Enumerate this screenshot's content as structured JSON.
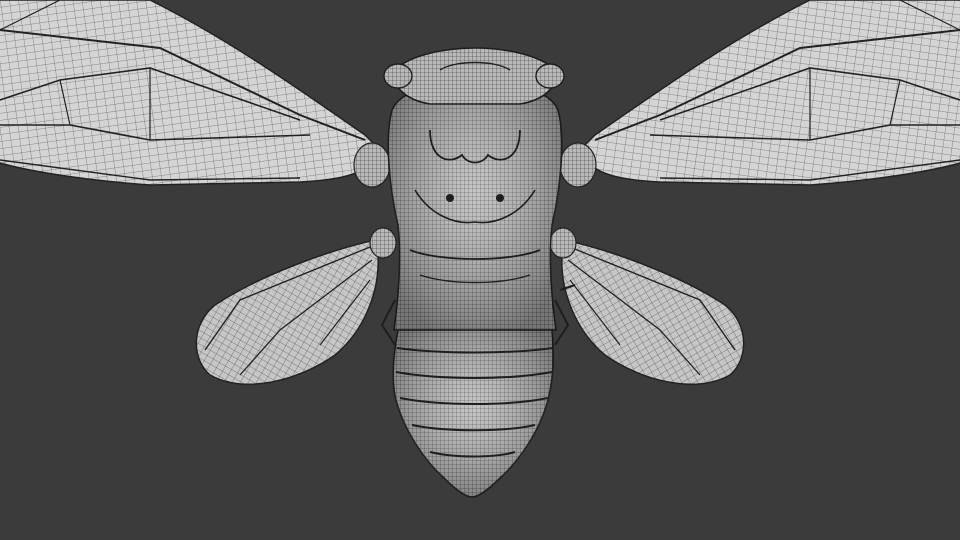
{
  "scene": {
    "background_color": "#3b3b3b",
    "mesh_fill_color": "#c9c9c9",
    "mesh_wire_color": "#1e1e1e",
    "subject": "cicada-wireframe-model"
  }
}
